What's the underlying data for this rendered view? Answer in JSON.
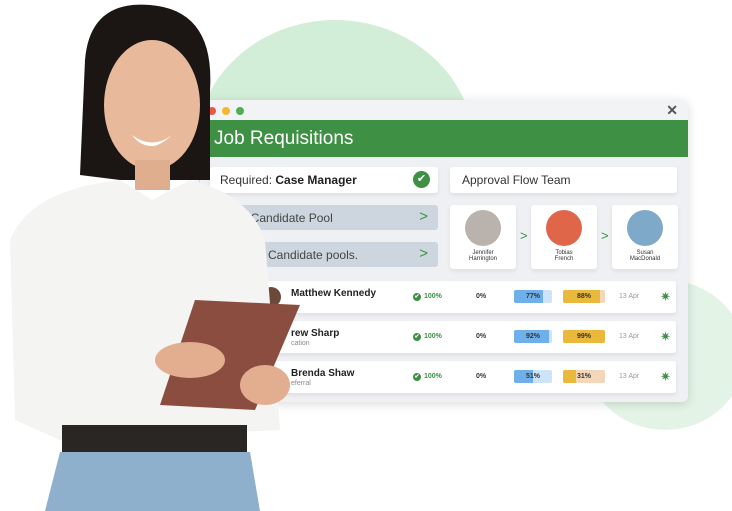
{
  "window": {
    "title": "Job Requisitions",
    "close_icon": "close-icon"
  },
  "required": {
    "label": "Required:",
    "value": "Case Manager"
  },
  "approval_title": "Approval Flow Team",
  "pools": [
    {
      "label": "reate Candidate Pool"
    },
    {
      "label": "Candidate pools."
    }
  ],
  "approvers": [
    {
      "first": "Jennifer",
      "last": "Harrington",
      "color": "#b9b2ad"
    },
    {
      "first": "Tobias",
      "last": "French",
      "color": "#e0664a"
    },
    {
      "first": "Susan",
      "last": "MacDonald",
      "color": "#7fa9c9"
    }
  ],
  "candidates": [
    {
      "name": "Matthew Kennedy",
      "source": "",
      "check": "100%",
      "zero": "0%",
      "blue": 77,
      "blue_label": "77%",
      "yellow": 88,
      "yellow_label": "88%",
      "date": "13 Apr"
    },
    {
      "name": "rew Sharp",
      "source": "cation",
      "check": "100%",
      "zero": "0%",
      "blue": 92,
      "blue_label": "92%",
      "yellow": 99,
      "yellow_label": "99%",
      "date": "13 Apr"
    },
    {
      "name": "Brenda Shaw",
      "source": "eferral",
      "check": "100%",
      "zero": "0%",
      "blue": 51,
      "blue_label": "51%",
      "yellow": 31,
      "yellow_label": "31%",
      "date": "13 Apr"
    }
  ],
  "colors": {
    "accent": "#3d9044",
    "blue": "#6fb0ea",
    "blue_bg": "#cde3f7",
    "yellow": "#eab83a",
    "yellow_bg": "#f2d7b8"
  }
}
